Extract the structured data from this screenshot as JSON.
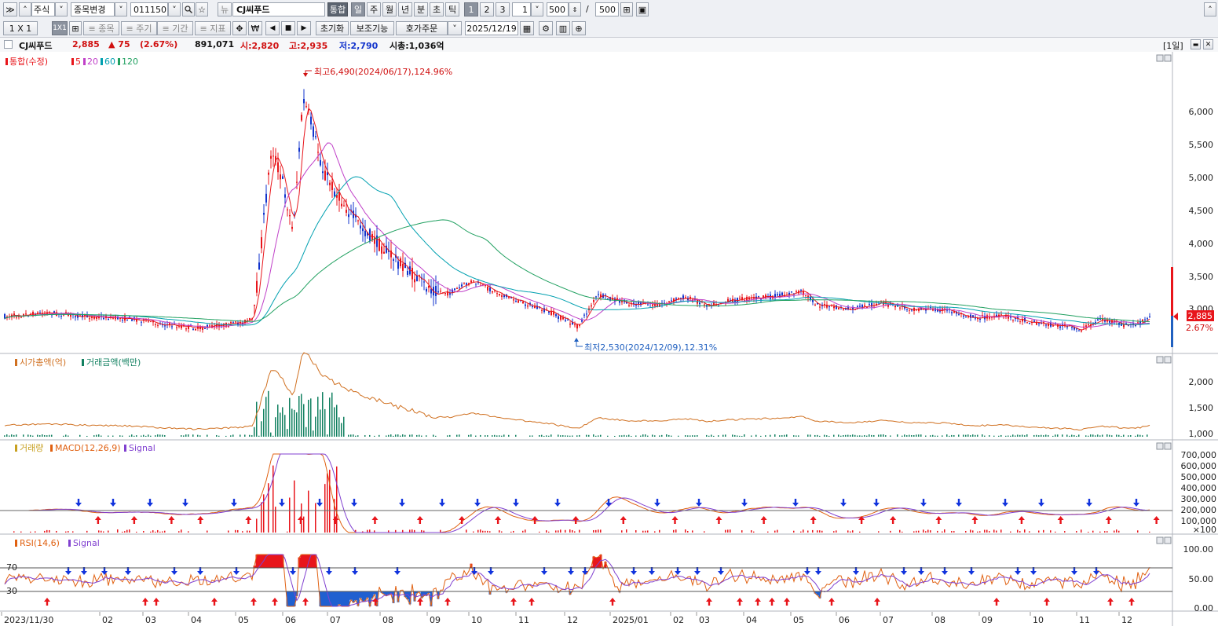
{
  "toolbar1": {
    "expand": "≫",
    "market": "주식",
    "change_item": "종목변경",
    "code": "011150",
    "stock_name": "CJ씨푸드",
    "integrated": "통합",
    "periods": [
      "일",
      "주",
      "월",
      "년",
      "분",
      "초",
      "틱"
    ],
    "nums": [
      "1",
      "2",
      "3"
    ],
    "n_value": "1",
    "count": "500",
    "slash": "/",
    "total": "500"
  },
  "toolbar2": {
    "layout_a": "1 X 1",
    "layout_b": "1X1",
    "item_btn": "≡ 종목",
    "cycle_btn": "≡ 주기",
    "period_btn": "≡ 기간",
    "indicator_btn": "≡ 지표",
    "won": "₩",
    "reset": "초기화",
    "aux": "보조기능",
    "order": "호가주문",
    "date": "2025/12/19"
  },
  "quote": {
    "name": "CJ씨푸드",
    "price": "2,885",
    "change": "▲ 75",
    "pct": "(2.67%)",
    "volume": "891,071",
    "open": "시:2,820",
    "high": "고:2,935",
    "low": "저:2,790",
    "mcap": "시총:1,036억",
    "interval": "[1일]"
  },
  "price_panel": {
    "legend_main": "통합(수정)",
    "legend_ma": [
      "5",
      "20",
      "60",
      "120"
    ],
    "max_label": "최고6,490(2024/06/17),124.96%",
    "min_label": "최저2,530(2024/12/09),12.31%",
    "y_ticks": [
      "6,000",
      "5,500",
      "5,000",
      "4,500",
      "4,000",
      "3,500",
      "3,000"
    ],
    "current_price": "2,885",
    "current_pct": "2.67%"
  },
  "mcap_panel": {
    "legend_a": "시가총액(억)",
    "legend_b": "거래금액(백만)",
    "y_ticks": [
      "2,000",
      "1,500",
      "1,000"
    ]
  },
  "macd_panel": {
    "legend_a": "거래량",
    "legend_b": "MACD(12,26,9)",
    "legend_c": "Signal",
    "y_ticks": [
      "700,000",
      "600,000",
      "500,000",
      "400,000",
      "300,000",
      "200,000",
      "100,000"
    ],
    "unit": "×100"
  },
  "rsi_panel": {
    "legend_a": "RSI(14,6)",
    "legend_b": "Signal",
    "lvl_hi": "70",
    "lvl_lo": "30",
    "y_ticks": [
      "100.00",
      "50.00",
      "0.00"
    ]
  },
  "x_axis": [
    "2023/11/30",
    "02",
    "03",
    "04",
    "05",
    "06",
    "07",
    "08",
    "09",
    "10",
    "11",
    "12",
    "2025/01",
    "02",
    "03",
    "04",
    "05",
    "06",
    "07",
    "08",
    "09",
    "10",
    "11",
    "12"
  ],
  "colors": {
    "up": "#e8151b",
    "down": "#1133cc",
    "ma5": "#e8151b",
    "ma20": "#c040c8",
    "ma60": "#00a0b0",
    "ma120": "#20a060",
    "mcap": "#d07020",
    "amount": "#118060",
    "macd": "#e06010",
    "signal": "#8040d0",
    "rsi": "#e06010"
  }
}
